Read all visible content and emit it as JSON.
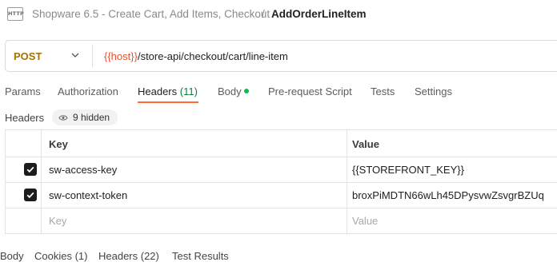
{
  "breadcrumb": {
    "icon_text": "HTTP",
    "parent": "Shopware 6.5 - Create Cart, Add Items, Checkout",
    "separator": "/",
    "current": "AddOrderLineItem"
  },
  "request": {
    "method": "POST",
    "url_variable": "{{host}}",
    "url_path": "/store-api/checkout/cart/line-item"
  },
  "tabs": {
    "params": "Params",
    "authorization": "Authorization",
    "headers": "Headers",
    "headers_count": "(11)",
    "body": "Body",
    "pre_request_script": "Pre-request Script",
    "tests": "Tests",
    "settings": "Settings",
    "active": "headers"
  },
  "headers_section": {
    "label": "Headers",
    "hidden_label": "9 hidden"
  },
  "headers_table": {
    "columns": {
      "key": "Key",
      "value": "Value"
    },
    "rows": [
      {
        "checked": true,
        "key": "sw-access-key",
        "value": "{{STOREFRONT_KEY}}"
      },
      {
        "checked": true,
        "key": "sw-context-token",
        "value": "broxPiMDTN66wLh45DPysvwZsvgrBZUq"
      }
    ],
    "new_row": {
      "key_placeholder": "Key",
      "value_placeholder": "Value"
    }
  },
  "response_tabs": {
    "body": "Body",
    "cookies": "Cookies (1)",
    "headers": "Headers (22)",
    "test_results": "Test Results"
  },
  "colors": {
    "method": "#a96f00",
    "variable": "#e5532f",
    "accent_underline": "#ff6c37",
    "count": "#0a7f3a",
    "body_dot": "#0cbb52"
  }
}
